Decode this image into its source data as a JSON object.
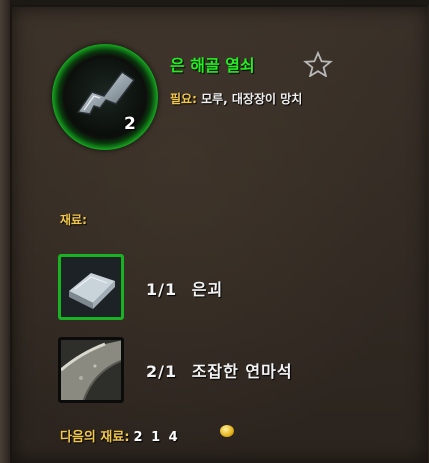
{
  "recipe": {
    "name": "은 해골 열쇠",
    "quantity": "2",
    "tools_label": "필요:",
    "tools_value": "모루, 대장장이 망치",
    "favorite_icon": "star-outline-icon",
    "main_icon": "silver-skeleton-key-icon"
  },
  "reagents": {
    "header": "재료:",
    "items": [
      {
        "count": "1/1",
        "name": "은괴",
        "icon": "silver-bar-icon",
        "available": true
      },
      {
        "count": "2/1",
        "name": "조잡한 연마석",
        "icon": "coarse-sharpening-stone-icon",
        "available": false
      }
    ]
  },
  "cost": {
    "label": "다음의 재료:",
    "value": "2 1 4",
    "icon": "gold-coin-icon"
  },
  "colors": {
    "title_green": "#22ee22",
    "label_gold": "#f2c84b",
    "border_green": "#18b322",
    "panel_bg": "#322a23"
  }
}
